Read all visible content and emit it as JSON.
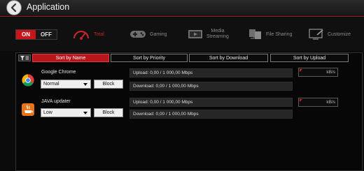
{
  "window": {
    "title": "Application"
  },
  "toggle": {
    "on_label": "ON",
    "off_label": "OFF"
  },
  "categories": [
    {
      "label": "Total",
      "icon": "speedometer-icon"
    },
    {
      "label": "Gaming",
      "icon": "gamepad-icon"
    },
    {
      "label_line1": "Media",
      "label_line2": "Streaming",
      "icon": "media-streaming-icon"
    },
    {
      "label": "File Sharing",
      "icon": "file-sharing-icon"
    },
    {
      "label": "Customize",
      "icon": "customize-icon"
    }
  ],
  "sort_tabs": [
    {
      "label": "Sort by Name",
      "active": true
    },
    {
      "label": "Sort by Priority",
      "active": false
    },
    {
      "label": "Sort by Download",
      "active": false
    },
    {
      "label": "Sort by Upload",
      "active": false
    }
  ],
  "apps": [
    {
      "name": "Google Chrome",
      "icon": "chrome-icon",
      "priority": "Normal",
      "block_label": "Block",
      "upload": "Upload: 0,00 / 1 000,00 Mbps",
      "download": "Download: 0,00 / 1 000,00 Mbps",
      "unit": "kB/s"
    },
    {
      "name": "JAVA updater",
      "icon": "java-icon",
      "priority": "Low",
      "block_label": "Block",
      "upload": "Upload: 0,00 / 1 000,00 Mbps",
      "download": "Download: 0,00 / 1 000,00 Mbps",
      "unit": "kB/s"
    }
  ],
  "colors": {
    "accent": "#c8151b",
    "background": "#0b0b0b"
  }
}
